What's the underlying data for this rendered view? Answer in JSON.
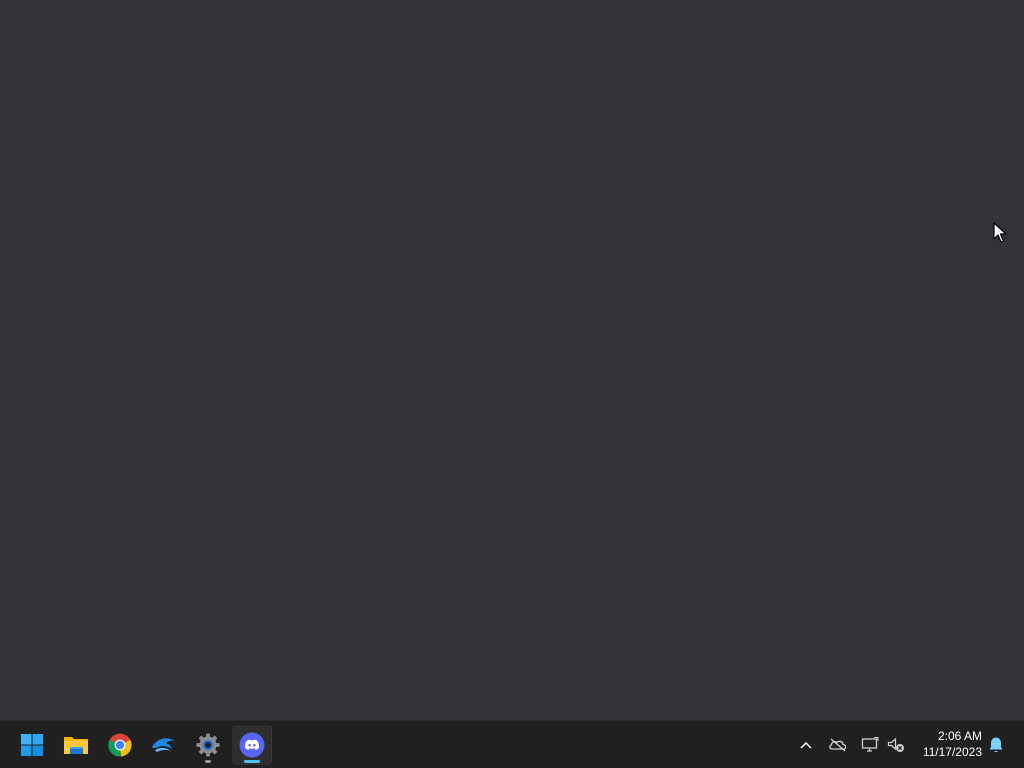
{
  "desktop": {
    "background_color": "#313338"
  },
  "taskbar": {
    "background_color": "#202020",
    "apps": [
      {
        "name": "Start",
        "icon": "windows-start-icon"
      },
      {
        "name": "File Explorer",
        "icon": "folder-icon"
      },
      {
        "name": "Google Chrome",
        "icon": "chrome-icon"
      },
      {
        "name": "Dolphin",
        "icon": "dolphin-icon"
      },
      {
        "name": "Settings",
        "icon": "gear-icon",
        "running": true
      },
      {
        "name": "Discord",
        "icon": "discord-icon",
        "running": true,
        "focused": true
      }
    ],
    "tray": {
      "icons": [
        "chevron-up-icon",
        "onedrive-offline-icon",
        "network-disconnected-icon",
        "speaker-muted-icon",
        "notification-bell-icon"
      ],
      "time": "2:06 AM",
      "date": "11/17/2023"
    },
    "accent_color": "#4cc2ff"
  }
}
